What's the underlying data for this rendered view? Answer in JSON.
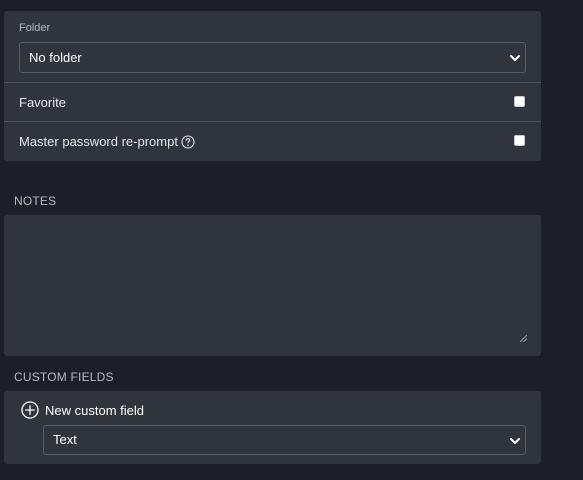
{
  "folder": {
    "label": "Folder",
    "selected": "No folder"
  },
  "favorite": {
    "label": "Favorite",
    "checked": false
  },
  "reprompt": {
    "label": "Master password re-prompt",
    "checked": false
  },
  "notes": {
    "heading": "NOTES",
    "value": ""
  },
  "custom_fields": {
    "heading": "CUSTOM FIELDS",
    "add_label": "New custom field",
    "type_selected": "Text"
  },
  "icons": {
    "help": "question-circle-icon",
    "add": "plus-circle-icon",
    "chevron": "chevron-down-icon"
  },
  "colors": {
    "background": "#1c1f26",
    "panel": "#2f343d",
    "border": "#565c66",
    "divider": "#4a4f58"
  }
}
